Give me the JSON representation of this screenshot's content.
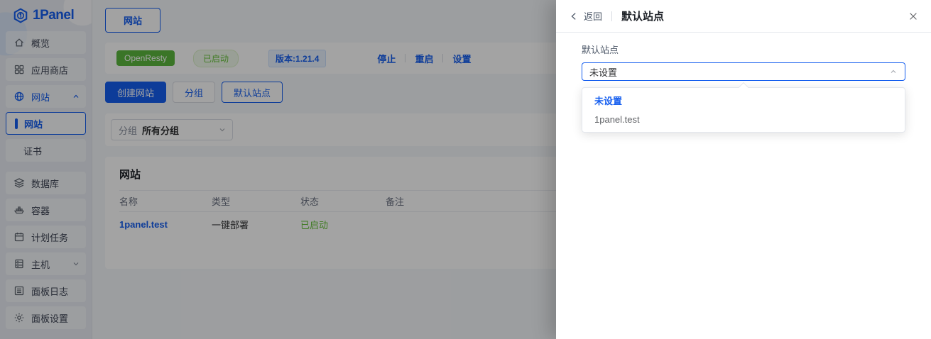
{
  "brand": {
    "name": "1Panel"
  },
  "sidebar": {
    "items": [
      {
        "label": "概览"
      },
      {
        "label": "应用商店"
      },
      {
        "label": "网站"
      },
      {
        "label": "网站"
      },
      {
        "label": "证书"
      },
      {
        "label": "数据库"
      },
      {
        "label": "容器"
      },
      {
        "label": "计划任务"
      },
      {
        "label": "主机"
      },
      {
        "label": "面板日志"
      },
      {
        "label": "面板设置"
      }
    ]
  },
  "main": {
    "tab": "网站",
    "status": {
      "app": "OpenResty",
      "state": "已启动",
      "version": "版本:1.21.4",
      "actions": [
        "停止",
        "重启",
        "设置"
      ]
    },
    "toolbar": {
      "create": "创建网站",
      "group": "分组",
      "default_site": "默认站点"
    },
    "filter": {
      "label": "分组",
      "value": "所有分组"
    },
    "table": {
      "title": "网站",
      "columns": [
        "名称",
        "类型",
        "状态",
        "备注"
      ],
      "rows": [
        {
          "name": "1panel.test",
          "type": "一键部署",
          "status": "已启动",
          "remark": ""
        }
      ]
    }
  },
  "drawer": {
    "back": "返回",
    "title": "默认站点",
    "form": {
      "label": "默认站点",
      "value": "未设置"
    },
    "options": [
      {
        "label": "未设置"
      },
      {
        "label": "1panel.test"
      }
    ]
  },
  "colors": {
    "primary": "#155eef",
    "success_badge": "#5cb83e",
    "success_text": "#67c23a"
  }
}
